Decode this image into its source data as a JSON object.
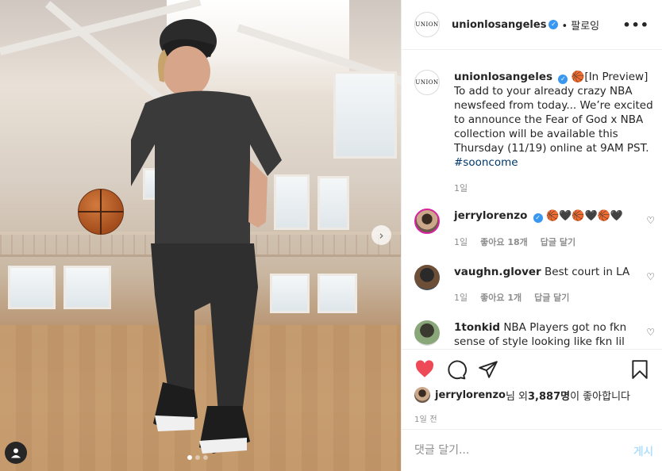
{
  "post": {
    "account": "unionlosangeles",
    "logo_text": "UNION",
    "follow_label": "• 팔로잉",
    "more_label": "•••"
  },
  "caption": {
    "user": "unionlosangeles",
    "text": "🏀[In Preview] To add to your already crazy NBA newsfeed from today... We’re excited to announce the Fear of God x NBA collection will be available this Thursday (11/19) online at 9AM PST.",
    "hashtag": "#sooncome",
    "time": "1일"
  },
  "comments": [
    {
      "user": "jerrylorenzo",
      "verified": true,
      "text": "🏀🖤🏀🖤🏀🖤",
      "time": "1일",
      "likes": "좋아요 18개",
      "reply": "답글 달기"
    },
    {
      "user": "vaughn.glover",
      "verified": false,
      "text": "Best court in LA",
      "time": "1일",
      "likes": "좋아요 1개",
      "reply": "답글 달기"
    },
    {
      "user": "1tonkid",
      "verified": false,
      "text": "NBA Players got no fkn sense of style looking like fkn lil"
    }
  ],
  "likes": {
    "user": "jerrylorenzo",
    "middle": "님 외 ",
    "count": "3,887명",
    "suffix": "이 좋아합니다"
  },
  "time_ago": "1일 전",
  "add_comment": {
    "placeholder": "댓글 달기...",
    "post_label": "게시"
  },
  "icons": [
    "heart-icon",
    "comment-icon",
    "share-icon",
    "bookmark-icon",
    "tag-user-icon",
    "next-arrow-icon"
  ],
  "colors": {
    "like_red": "#ed4956",
    "verified_blue": "#3897f0",
    "hashtag": "#00376b",
    "post_btn": "#b2dffc"
  },
  "carousel": {
    "current_slide": 1,
    "total_slides": 3
  }
}
